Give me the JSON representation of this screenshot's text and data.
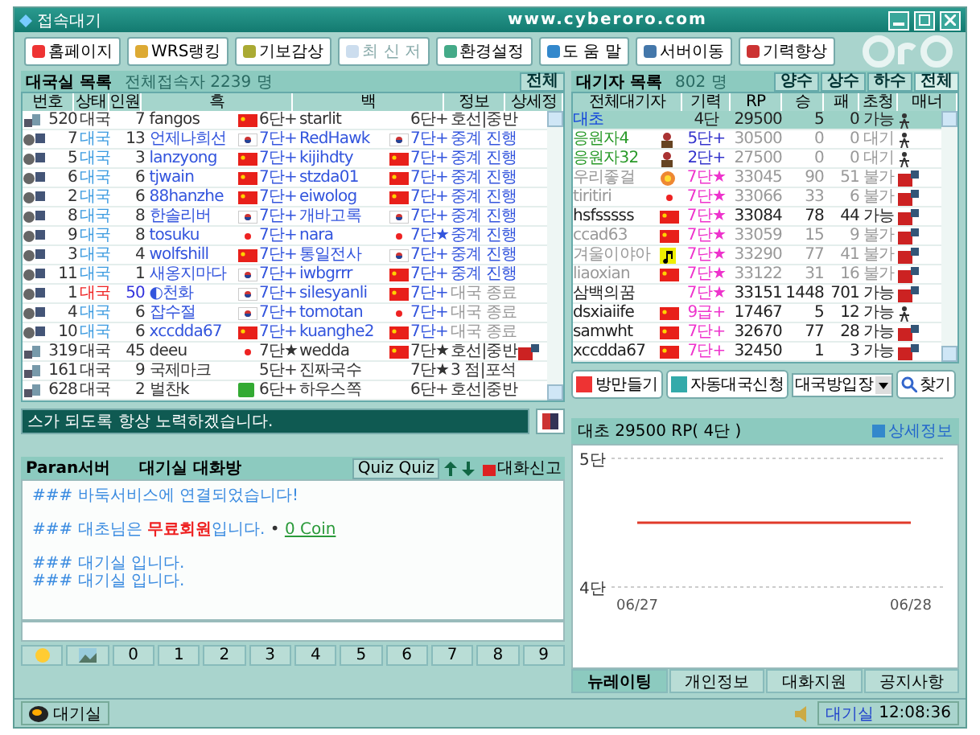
{
  "window": {
    "title": "접속대기",
    "url": "www.cyberoro.com"
  },
  "toolbar": [
    {
      "label": "홈페이지",
      "disabled": false
    },
    {
      "label": "WRS랭킹",
      "disabled": false
    },
    {
      "label": "기보감상",
      "disabled": false
    },
    {
      "label": "최 신 저",
      "disabled": true
    },
    {
      "label": "환경설정",
      "disabled": false
    },
    {
      "label": "도 움 말",
      "disabled": false
    },
    {
      "label": "서버이동",
      "disabled": false
    },
    {
      "label": "기력향상",
      "disabled": false
    }
  ],
  "rooms": {
    "title": "대국실 목록",
    "count_label": "전체접속자 2239 명",
    "filter_button": "전체",
    "columns": [
      "번호",
      "상태",
      "인원",
      "흑",
      "백",
      "정보",
      "상세정"
    ],
    "rows": [
      {
        "kind": "amateur",
        "no": "520",
        "state": "대국",
        "alert": false,
        "count": "7",
        "black": "fangos",
        "black_flag": {
          "kind": "cn"
        },
        "black_rank": "6단+",
        "white": "starlit",
        "white_rank": "6단+",
        "info": "호선|중반",
        "finished": false
      },
      {
        "kind": "pro",
        "no": "7",
        "state": "대국",
        "alert": false,
        "count": "13",
        "black": "언제나희선",
        "black_flag": {
          "kind": "kr"
        },
        "black_rank": "7단+",
        "white": "RedHawk",
        "white_flag": {
          "kind": "kr"
        },
        "white_rank": "7단+",
        "info": "중계 진행",
        "finished": false
      },
      {
        "kind": "pro",
        "no": "5",
        "state": "대국",
        "alert": false,
        "count": "3",
        "black": "lanzyong",
        "black_flag": {
          "kind": "cn"
        },
        "black_rank": "7단+",
        "white": "kijihdty",
        "white_flag": {
          "kind": "cn"
        },
        "white_rank": "7단+",
        "info": "중계 진행",
        "finished": false
      },
      {
        "kind": "pro",
        "no": "6",
        "state": "대국",
        "alert": false,
        "count": "6",
        "black": "tjwain",
        "black_flag": {
          "kind": "cn"
        },
        "black_rank": "7단+",
        "white": "stzda01",
        "white_flag": {
          "kind": "cn"
        },
        "white_rank": "7단+",
        "info": "중계 진행",
        "finished": false
      },
      {
        "kind": "pro",
        "no": "2",
        "state": "대국",
        "alert": false,
        "count": "6",
        "black": "88hanzhe",
        "black_flag": {
          "kind": "cn"
        },
        "black_rank": "7단+",
        "white": "eiwolog",
        "white_flag": {
          "kind": "cn"
        },
        "white_rank": "7단+",
        "info": "중계 진행",
        "finished": false
      },
      {
        "kind": "pro",
        "no": "8",
        "state": "대국",
        "alert": false,
        "count": "8",
        "black": "한솔리버",
        "black_flag": {
          "kind": "kr"
        },
        "black_rank": "7단+",
        "white": "개바고록",
        "white_flag": {
          "kind": "kr"
        },
        "white_rank": "7단+",
        "info": "중계 진행",
        "finished": false
      },
      {
        "kind": "pro",
        "no": "9",
        "state": "대국",
        "alert": false,
        "count": "8",
        "black": "tosuku",
        "black_flag": {
          "kind": "jp"
        },
        "black_rank": "7단+",
        "white": "nara",
        "white_flag": {
          "kind": "jp"
        },
        "white_rank": "7단★",
        "info": "중계 진행",
        "finished": false
      },
      {
        "kind": "pro",
        "no": "3",
        "state": "대국",
        "alert": false,
        "count": "4",
        "black": "wolfshill",
        "black_flag": {
          "kind": "cn"
        },
        "black_rank": "7단+",
        "white": "통일전사",
        "white_flag": {
          "kind": "kr"
        },
        "white_rank": "7단+",
        "info": "중계 진행",
        "finished": false
      },
      {
        "kind": "pro",
        "no": "11",
        "state": "대국",
        "alert": false,
        "count": "1",
        "black": "새옹지마다",
        "black_flag": {
          "kind": "kr"
        },
        "black_rank": "7단+",
        "white": "iwbgrrr",
        "white_flag": {
          "kind": "cn"
        },
        "white_rank": "7단+",
        "info": "중계 진행",
        "finished": false
      },
      {
        "kind": "pro",
        "no": "1",
        "state": "대국",
        "alert": true,
        "count": "50",
        "black": "◐천화",
        "black_flag": {
          "kind": "kr"
        },
        "black_rank": "7단+",
        "white": "silesyanli",
        "white_flag": {
          "kind": "cn"
        },
        "white_rank": "7단+",
        "info": "대국 종료",
        "finished": true
      },
      {
        "kind": "pro",
        "no": "4",
        "state": "대국",
        "alert": false,
        "count": "6",
        "black": "잡수절",
        "black_flag": {
          "kind": "kr"
        },
        "black_rank": "7단+",
        "white": "tomotan",
        "white_flag": {
          "kind": "jp"
        },
        "white_rank": "7단+",
        "info": "대국 종료",
        "finished": true
      },
      {
        "kind": "pro",
        "no": "10",
        "state": "대국",
        "alert": false,
        "count": "6",
        "black": "xccdda67",
        "black_flag": {
          "kind": "cn"
        },
        "black_rank": "7단+",
        "white": "kuanghe2",
        "white_flag": {
          "kind": "cn"
        },
        "white_rank": "7단+",
        "info": "대국 종료",
        "finished": true
      },
      {
        "kind": "amateur",
        "no": "319",
        "state": "대국",
        "alert": false,
        "count": "45",
        "black": "deeu",
        "black_flag": {
          "kind": "jp"
        },
        "black_rank": "7단★",
        "white": "wedda",
        "white_flag": {
          "kind": "cn"
        },
        "white_rank": "7단★",
        "info": "호선|중반",
        "finished": false
      },
      {
        "kind": "amateur",
        "no": "161",
        "state": "대국",
        "alert": false,
        "count": "9",
        "black": "국제마크",
        "black_rank": "5단+",
        "white": "진짜국수",
        "white_rank": "7단★",
        "info": "3 점|포석",
        "finished": false
      },
      {
        "kind": "amateur",
        "no": "628",
        "state": "대국",
        "alert": false,
        "count": "2",
        "black": "벌찬k",
        "black_flag": {
          "kind": "other"
        },
        "black_rank": "6단+",
        "white": "하우스쪽",
        "white_rank": "6단+",
        "info": "호선|중반",
        "finished": false
      }
    ]
  },
  "notice": "스가 되도록 항상 노력하겠습니다.",
  "chat": {
    "server": "Paran서버",
    "title": "대기실 대화방",
    "quiz": "Quiz Quiz",
    "report": "대화신고",
    "messages": [
      {
        "spaced": false,
        "parts": [
          {
            "kind": "plain",
            "text": "### 바둑서비스에 연결되었습니다!"
          }
        ]
      },
      {
        "spaced": true,
        "parts": [
          {
            "kind": "plain",
            "text": "### 대초님은 "
          },
          {
            "kind": "alert",
            "text": "무료회원"
          },
          {
            "kind": "plain",
            "text": "입니다. "
          },
          {
            "kind": "bullet",
            "text": "• "
          },
          {
            "kind": "link",
            "text": "0 Coin"
          }
        ]
      },
      {
        "spaced": true,
        "parts": [
          {
            "kind": "plain",
            "text": "### 대기실 입니다."
          }
        ]
      },
      {
        "spaced": false,
        "parts": [
          {
            "kind": "plain",
            "text": "### 대기실 입니다."
          }
        ]
      }
    ]
  },
  "quick_buttons": [
    {
      "kind": "emoji"
    },
    {
      "kind": "image"
    },
    {
      "kind": "digit",
      "label": "0"
    },
    {
      "kind": "digit",
      "label": "1"
    },
    {
      "kind": "digit",
      "label": "2"
    },
    {
      "kind": "digit",
      "label": "3"
    },
    {
      "kind": "digit",
      "label": "4"
    },
    {
      "kind": "digit",
      "label": "5"
    },
    {
      "kind": "digit",
      "label": "6"
    },
    {
      "kind": "digit",
      "label": "7"
    },
    {
      "kind": "digit",
      "label": "8"
    },
    {
      "kind": "digit",
      "label": "9"
    }
  ],
  "waiting": {
    "title": "대기자 목록",
    "count_label": "802 명",
    "filters": [
      {
        "label": "양수",
        "selected": false
      },
      {
        "label": "상수",
        "selected": false
      },
      {
        "label": "하수",
        "selected": false
      },
      {
        "label": "전체",
        "selected": true
      }
    ],
    "columns": [
      "전체대기자",
      "기력",
      "RP",
      "승",
      "패",
      "초청",
      "매너"
    ],
    "rows": [
      {
        "kind": "self",
        "selected": true,
        "name": "대초",
        "rank": "4단",
        "rp": "29500",
        "wins": "5",
        "losses": "0",
        "invite": "가능",
        "manner": {
          "kind": "walker"
        }
      },
      {
        "kind": "helper",
        "selected": false,
        "name": "응원자4",
        "flag": {
          "kind": "avatar"
        },
        "rank": "5단+",
        "rp": "30500",
        "wins": "0",
        "losses": "0",
        "invite": "대기",
        "manner": {
          "kind": "walker"
        }
      },
      {
        "kind": "helper",
        "selected": false,
        "name": "응원자32",
        "flag": {
          "kind": "avatar"
        },
        "rank": "2단+",
        "rp": "27500",
        "wins": "0",
        "losses": "0",
        "invite": "대기",
        "manner": {
          "kind": "walker"
        }
      },
      {
        "kind": "busy",
        "selected": false,
        "name": "우리좋걸",
        "flag": {
          "kind": "badge"
        },
        "rank": "7단★",
        "rp": "33045",
        "wins": "90",
        "losses": "51",
        "invite": "불가",
        "manner": {
          "kind": "board"
        }
      },
      {
        "kind": "busy",
        "selected": false,
        "name": "tiritiri",
        "flag": {
          "kind": "jp"
        },
        "rank": "7단★",
        "rp": "33066",
        "wins": "33",
        "losses": "6",
        "invite": "불가",
        "manner": {
          "kind": "board"
        }
      },
      {
        "kind": "free",
        "selected": false,
        "name": "hsfsssss",
        "flag": {
          "kind": "cn"
        },
        "rank": "7단★",
        "rp": "33084",
        "wins": "78",
        "losses": "44",
        "invite": "가능",
        "manner": {
          "kind": "board"
        }
      },
      {
        "kind": "busy",
        "selected": false,
        "name": "ccad63",
        "flag": {
          "kind": "cn"
        },
        "rank": "7단★",
        "rp": "33059",
        "wins": "15",
        "losses": "9",
        "invite": "불가",
        "manner": {
          "kind": "board"
        }
      },
      {
        "kind": "busy",
        "selected": false,
        "name": "겨울이야아",
        "flag": {
          "kind": "music"
        },
        "rank": "7단★",
        "rp": "33290",
        "wins": "77",
        "losses": "41",
        "invite": "불가",
        "manner": {
          "kind": "board"
        }
      },
      {
        "kind": "busy",
        "selected": false,
        "name": "liaoxian",
        "flag": {
          "kind": "cn"
        },
        "rank": "7단★",
        "rp": "33122",
        "wins": "31",
        "losses": "16",
        "invite": "불가",
        "manner": {
          "kind": "board"
        }
      },
      {
        "kind": "free",
        "selected": false,
        "name": "삼백의꿈",
        "rank": "7단★",
        "rp": "33151",
        "wins": "1448",
        "losses": "701",
        "invite": "가능",
        "manner": {
          "kind": "board"
        }
      },
      {
        "kind": "free",
        "selected": false,
        "name": "dsxiaiife",
        "flag": {
          "kind": "cn"
        },
        "rank": "9급+",
        "rp": "17467",
        "wins": "5",
        "losses": "12",
        "invite": "가능",
        "manner": {
          "kind": "walker"
        }
      },
      {
        "kind": "free",
        "selected": false,
        "name": "samwht",
        "flag": {
          "kind": "cn"
        },
        "rank": "7단+",
        "rp": "32670",
        "wins": "77",
        "losses": "28",
        "invite": "가능",
        "manner": {
          "kind": "board"
        }
      },
      {
        "kind": "free",
        "selected": false,
        "name": "xccdda67",
        "flag": {
          "kind": "cn"
        },
        "rank": "7단+",
        "rp": "32450",
        "wins": "1",
        "losses": "3",
        "invite": "가능",
        "manner": {
          "kind": "board"
        }
      }
    ],
    "buttons": [
      "방만들기",
      "자동대국신청"
    ],
    "select": "대국방입장",
    "search": "찾기"
  },
  "profile": {
    "summary": "대초 29500 RP( 4단 )",
    "detail_link": "상세정보",
    "chart_data": {
      "type": "line",
      "x": [
        "06/27",
        "06/28"
      ],
      "ylim": [
        4,
        5
      ],
      "yticks": [
        {
          "value": 5,
          "label": "5단"
        },
        {
          "value": 4,
          "label": "4단"
        }
      ],
      "series": [
        {
          "color": "#e03a2a",
          "values": [
            4.5,
            4.5
          ]
        }
      ]
    }
  },
  "tabs": [
    {
      "label": "뉴레이팅",
      "selected": true
    },
    {
      "label": "개인정보",
      "selected": false
    },
    {
      "label": "대화지원",
      "selected": false
    },
    {
      "label": "공지사항",
      "selected": false
    }
  ],
  "status": {
    "location": "대기실",
    "right_location": "대기실",
    "time": "12:08:36"
  }
}
